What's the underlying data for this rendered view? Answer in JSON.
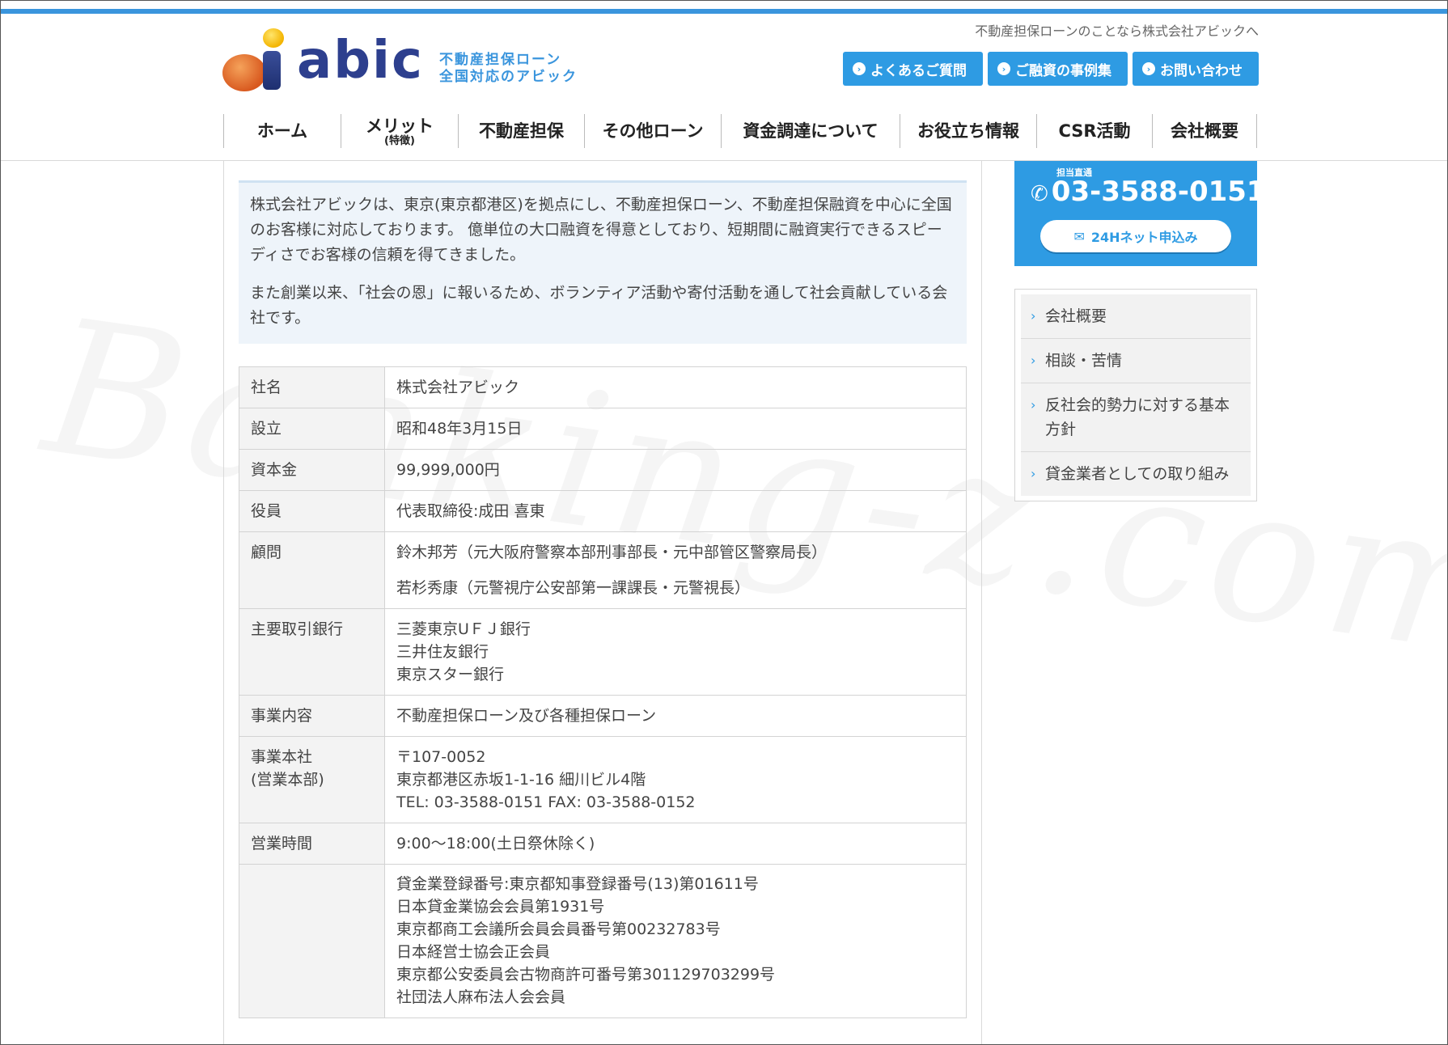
{
  "header": {
    "tagline": "不動産担保ローンのことなら株式会社アビックへ",
    "logo_word": "abic",
    "logo_sub_1": "不動産担保ローン",
    "logo_sub_2": "全国対応のアビック",
    "top_buttons": [
      {
        "label": "よくあるご質問"
      },
      {
        "label": "ご融資の事例集"
      },
      {
        "label": "お問い合わせ"
      }
    ]
  },
  "nav": [
    {
      "sub_top": "",
      "label": "ホーム",
      "sub": ""
    },
    {
      "sub_top": "",
      "label": "メリット",
      "sub": "(特徴)"
    },
    {
      "sub_top": "",
      "label": "不動産担保",
      "sub": ""
    },
    {
      "sub_top": "",
      "label": "その他ローン",
      "sub": ""
    },
    {
      "sub_top": "",
      "label": "資金調達について",
      "sub": ""
    },
    {
      "sub_top": "",
      "label": "お役立ち情報",
      "sub": ""
    },
    {
      "sub_top": "",
      "label": "CSR活動",
      "sub": ""
    },
    {
      "sub_top": "",
      "label": "会社概要",
      "sub": ""
    }
  ],
  "intro": {
    "p1": "株式会社アビックは、東京(東京都港区)を拠点にし、不動産担保ローン、不動産担保融資を中心に全国のお客様に対応しております。 億単位の大口融資を得意としており、短期間に融資実行できるスピーディさでお客様の信頼を得てきました。",
    "p2": "また創業以来、「社会の恩」に報いるため、ボランティア活動や寄付活動を通して社会貢献している会社です。"
  },
  "company": {
    "name_label": "社名",
    "name": "株式会社アビック",
    "est_label": "設立",
    "est": "昭和48年3月15日",
    "capital_label": "資本金",
    "capital": "99,999,000円",
    "officer_label": "役員",
    "officer": "代表取締役:成田 喜東",
    "advisor_label": "顧問",
    "advisor_1": "鈴木邦芳（元大阪府警察本部刑事部長・元中部管区警察局長）",
    "advisor_2": "若杉秀康（元警視庁公安部第一課課長・元警視長）",
    "bank_label": "主要取引銀行",
    "bank_1": "三菱東京UＦＪ銀行",
    "bank_2": "三井住友銀行",
    "bank_3": "東京スター銀行",
    "business_label": "事業内容",
    "business": "不動産担保ローン及び各種担保ローン",
    "hq_label_1": "事業本社",
    "hq_label_2": "(営業本部)",
    "hq_1": "〒107-0052",
    "hq_2": "東京都港区赤坂1-1-16 細川ビル4階",
    "hq_3": "TEL: 03-3588-0151 FAX: 03-3588-0152",
    "hours_label": "営業時間",
    "hours": "9:00～18:00(土日祭休除く)",
    "reg_1": "貸金業登録番号:東京都知事登録番号(13)第01611号",
    "reg_2": "日本貸金業協会会員第1931号",
    "reg_3": "東京都商工会議所会員会員番号第00232783号",
    "reg_4": "日本経営士協会正会員",
    "reg_5": "東京都公安委員会古物商許可番号第301129703299号",
    "reg_6": "社団法人麻布法人会会員"
  },
  "sidebar": {
    "phone_small": "担当直通",
    "phone": "03-3588-0151",
    "apply": "24Hネット申込み",
    "menu": [
      {
        "label": "会社概要"
      },
      {
        "label": "相談・苦情"
      },
      {
        "label": "反社会的勢力に対する基本方針"
      },
      {
        "label": "貸金業者としての取り組み"
      }
    ]
  },
  "watermark": "Banking-z.com",
  "colors": {
    "accent": "#2e9be3",
    "brand_dark": "#2d3f8e",
    "intro_bg": "#eef4fa"
  }
}
